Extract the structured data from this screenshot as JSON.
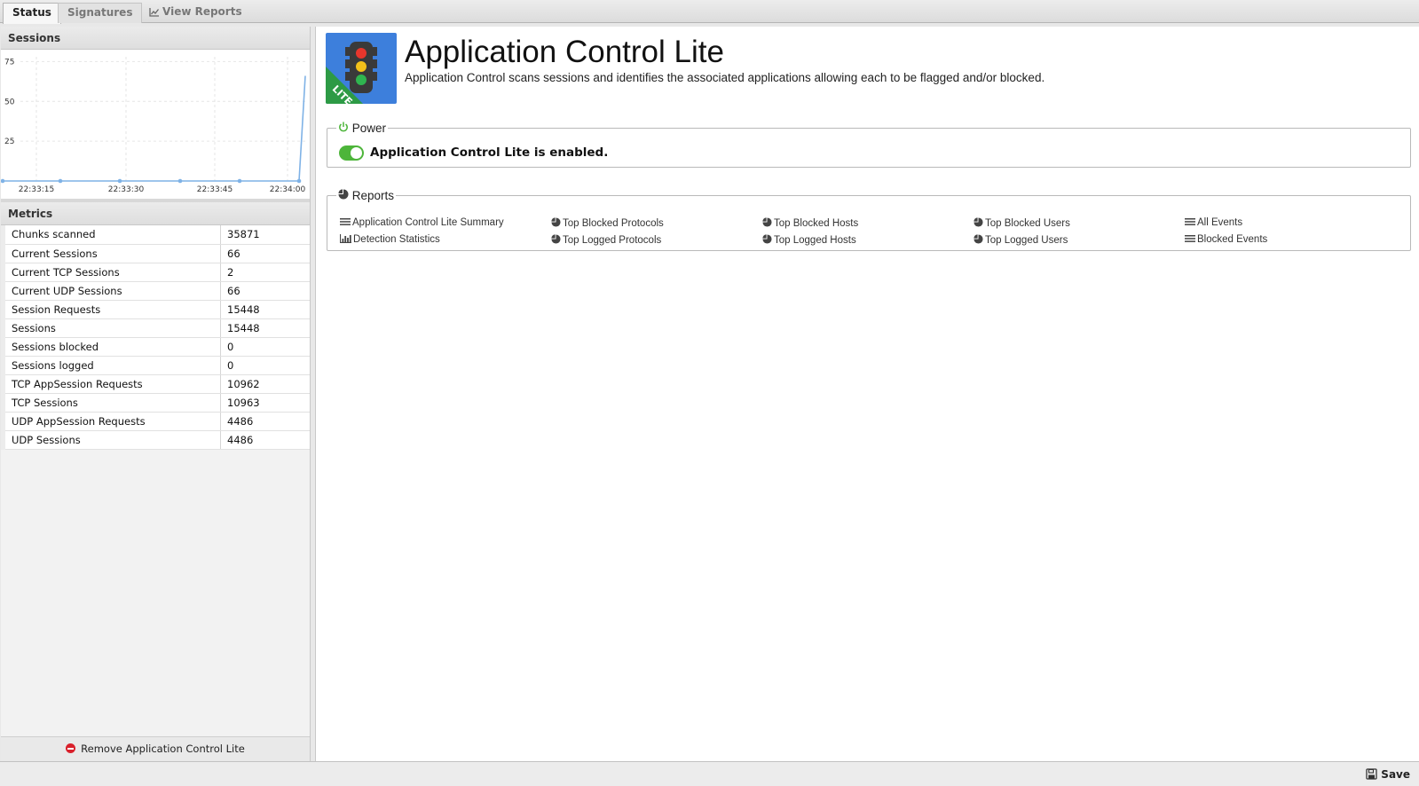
{
  "tabs": [
    {
      "label": "Status"
    },
    {
      "label": "Signatures"
    },
    {
      "label": "View Reports"
    }
  ],
  "sessions_panel": {
    "title": "Sessions"
  },
  "chart_data": {
    "type": "line",
    "title": "",
    "xlabel": "",
    "ylabel": "",
    "x_ticks": [
      "22:33:15",
      "22:33:30",
      "22:33:45",
      "22:34:00"
    ],
    "y_ticks": [
      25,
      50,
      75
    ],
    "ylim": [
      0,
      78
    ],
    "grid": true,
    "series": [
      {
        "values": [
          0,
          0,
          0,
          0,
          0,
          0,
          66
        ]
      }
    ],
    "color": "#7fb2e6"
  },
  "metrics_panel": {
    "title": "Metrics",
    "rows": [
      {
        "key": "Chunks scanned",
        "value": "35871"
      },
      {
        "key": "Current Sessions",
        "value": "66"
      },
      {
        "key": "Current TCP Sessions",
        "value": "2"
      },
      {
        "key": "Current UDP Sessions",
        "value": "66"
      },
      {
        "key": "Session Requests",
        "value": "15448"
      },
      {
        "key": "Sessions",
        "value": "15448"
      },
      {
        "key": "Sessions blocked",
        "value": "0"
      },
      {
        "key": "Sessions logged",
        "value": "0"
      },
      {
        "key": "TCP AppSession Requests",
        "value": "10962"
      },
      {
        "key": "TCP Sessions",
        "value": "10963"
      },
      {
        "key": "UDP AppSession Requests",
        "value": "4486"
      },
      {
        "key": "UDP Sessions",
        "value": "4486"
      }
    ]
  },
  "remove_button": {
    "label": "Remove Application Control Lite"
  },
  "app": {
    "title": "Application Control Lite",
    "description": "Application Control scans sessions and identifies the associated applications allowing each to be flagged and/or blocked.",
    "badge": "LITE"
  },
  "power": {
    "legend": "Power",
    "status": "Application Control Lite is enabled.",
    "enabled": true
  },
  "reports": {
    "legend": "Reports",
    "links": [
      {
        "label": "Application Control Lite Summary",
        "icon": "list-icon"
      },
      {
        "label": "Detection Statistics",
        "icon": "bar-chart-icon"
      },
      {
        "label": "Top Blocked Protocols",
        "icon": "pie-chart-icon"
      },
      {
        "label": "Top Logged Protocols",
        "icon": "pie-chart-icon"
      },
      {
        "label": "Top Blocked Hosts",
        "icon": "pie-chart-icon"
      },
      {
        "label": "Top Logged Hosts",
        "icon": "pie-chart-icon"
      },
      {
        "label": "Top Blocked Users",
        "icon": "pie-chart-icon"
      },
      {
        "label": "Top Logged Users",
        "icon": "pie-chart-icon"
      },
      {
        "label": "All Events",
        "icon": "list-icon"
      },
      {
        "label": "Blocked Events",
        "icon": "list-icon"
      }
    ]
  },
  "save_button": {
    "label": "Save"
  },
  "colors": {
    "accent": "#3d7fdc",
    "enabled_green": "#4db53a",
    "remove_red": "#d9202b"
  }
}
